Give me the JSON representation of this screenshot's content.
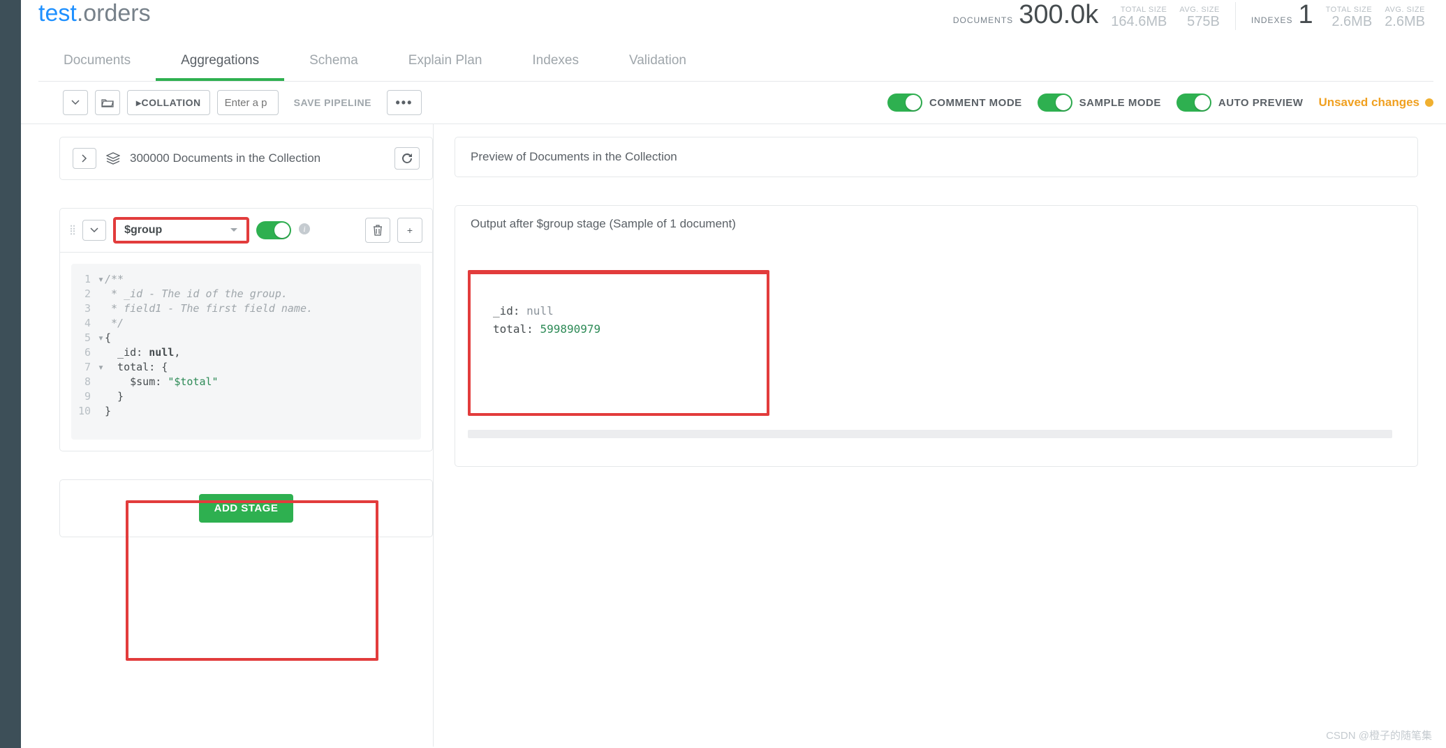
{
  "namespace": {
    "db": "test",
    "coll": ".orders"
  },
  "stats": {
    "documents_label": "DOCUMENTS",
    "documents_value": "300.0k",
    "total_size_label": "TOTAL SIZE",
    "total_size_value": "164.6MB",
    "avg_size_label": "AVG. SIZE",
    "avg_size_value": "575B",
    "indexes_label": "INDEXES",
    "indexes_value": "1",
    "idx_total_label": "TOTAL SIZE",
    "idx_total_value": "2.6MB",
    "idx_avg_label": "AVG. SIZE",
    "idx_avg_value": "2.6MB"
  },
  "tabs": {
    "documents": "Documents",
    "aggregations": "Aggregations",
    "schema": "Schema",
    "explain": "Explain Plan",
    "indexes": "Indexes",
    "validation": "Validation"
  },
  "toolbar": {
    "collation_btn": "COLLATION",
    "collation_placeholder": "Enter a p",
    "save_pipeline": "SAVE PIPELINE",
    "comment_mode": "COMMENT MODE",
    "sample_mode": "SAMPLE MODE",
    "auto_preview": "AUTO PREVIEW",
    "unsaved": "Unsaved changes"
  },
  "docs_summary": {
    "text": "300000 Documents in the Collection"
  },
  "preview": {
    "title": "Preview of Documents in the Collection"
  },
  "stage": {
    "operator": "$group",
    "output_title": "Output after $group stage (Sample of 1 document)",
    "code": {
      "l1": "/**",
      "l2": " * _id - The id of the group.",
      "l3": " * field1 - The first field name.",
      "l4": " */",
      "l5": "{",
      "l6": "  _id: ",
      "l6b": "null",
      "l6c": ",",
      "l7": "  total: {",
      "l8": "    $sum: ",
      "l8s": "\"$total\"",
      "l9": "  }",
      "l10": "}"
    },
    "result": {
      "id_key": "_id",
      "id_val": "null",
      "total_key": "total",
      "total_val": "599890979"
    }
  },
  "add_stage": "ADD STAGE",
  "watermark": "CSDN @橙子的随笔集"
}
